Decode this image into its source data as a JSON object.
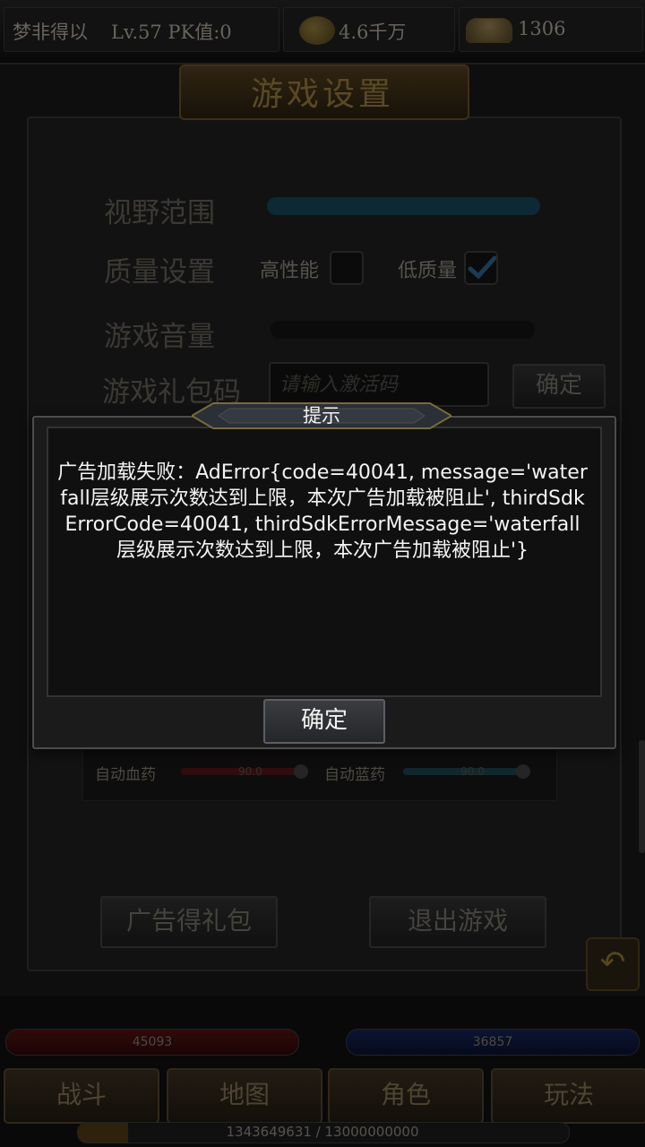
{
  "top_bar": {
    "player_name": "梦非得以",
    "level_pk": "Lv.57 PK值:0",
    "gold": "4.6千万",
    "ingots": "1306",
    "gold_icon": "gold-coins-icon",
    "ingot_icon": "gold-ingot-icon"
  },
  "settings": {
    "title": "游戏设置",
    "view_range_label": "视野范围",
    "quality_label": "质量设置",
    "high_perf_label": "高性能",
    "low_quality_label": "低质量",
    "high_perf_checked": false,
    "low_quality_checked": true,
    "volume_label": "游戏音量",
    "gift_code_label": "游戏礼包码",
    "gift_code_placeholder": "请输入激活码",
    "gift_code_confirm": "确定",
    "auto_hp_label": "自动血药",
    "auto_hp_value": "90.0",
    "auto_mp_label": "自动蓝药",
    "auto_mp_value": "90.0",
    "ad_gift_button": "广告得礼包",
    "exit_button": "退出游戏"
  },
  "hud": {
    "hp_value": "45093",
    "mp_value": "36857",
    "nav": [
      "战斗",
      "地图",
      "角色",
      "玩法"
    ],
    "exp_text": "1343649631 / 13000000000",
    "exp_fraction": 0.103
  },
  "dialog": {
    "title": "提示",
    "message": "广告加载失败：AdError{code=40041, message='waterfall层级展示次数达到上限，本次广告加载被阻止', thirdSdkErrorCode=40041, thirdSdkErrorMessage='waterfall层级展示次数达到上限，本次广告加载被阻止'}",
    "ok_button": "确定"
  },
  "colors": {
    "dialog_text": "#f4f4f4",
    "hp_bar": "#3a0d0d",
    "mp_bar": "#0f1a3c",
    "checkmark": "#1f4a66"
  }
}
